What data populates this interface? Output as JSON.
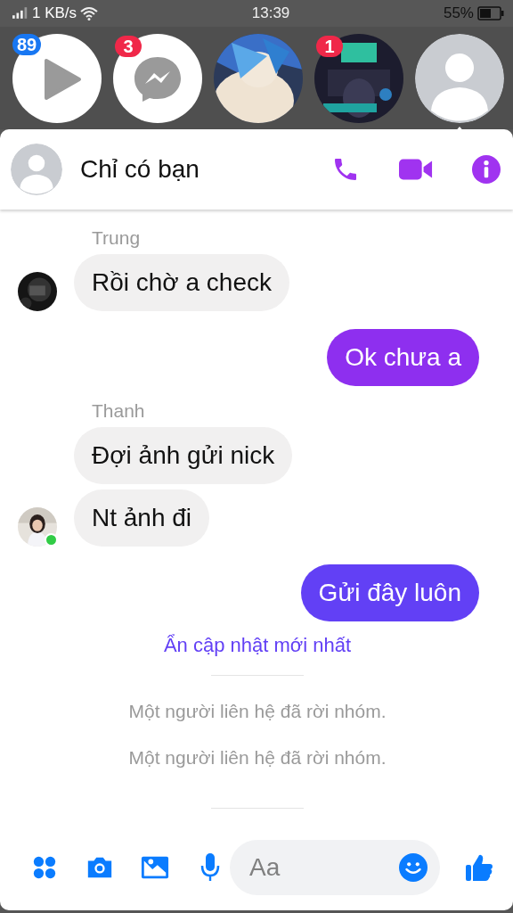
{
  "status_bar": {
    "speed": "1 KB/s",
    "time": "13:39",
    "battery": "55%"
  },
  "chat_heads": [
    {
      "kind": "play",
      "selected": false,
      "badge": {
        "text": "89",
        "color": "#1877f2"
      }
    },
    {
      "kind": "messenger",
      "selected": false,
      "badge": {
        "text": "3",
        "color": "#f02849"
      }
    },
    {
      "kind": "picture",
      "selected": false
    },
    {
      "kind": "picture",
      "selected": false,
      "badge": {
        "text": "1",
        "color": "#f02849"
      }
    },
    {
      "kind": "avatar",
      "selected": true
    }
  ],
  "header": {
    "title": "Chỉ có bạn"
  },
  "messages": [
    {
      "kind": "sender",
      "text": "Trung"
    },
    {
      "kind": "incoming",
      "text": "Rồi chờ a check",
      "avatar": {
        "online": false
      }
    },
    {
      "kind": "outgoing",
      "text": "Ok chưa a",
      "color": "#8e2fef"
    },
    {
      "kind": "sender",
      "text": "Thanh"
    },
    {
      "kind": "incoming",
      "text": "Đợi ảnh gửi nick"
    },
    {
      "kind": "incoming",
      "text": "Nt ảnh đi",
      "avatar": {
        "online": true
      }
    },
    {
      "kind": "outgoing",
      "text": "Gửi đây luôn",
      "color": "#6240f5"
    },
    {
      "kind": "link",
      "text": "Ẩn cập nhật mới nhất"
    },
    {
      "kind": "divider"
    },
    {
      "kind": "notice",
      "text": "Một người liên hệ đã rời nhóm."
    },
    {
      "kind": "notice",
      "text": "Một người liên hệ đã rời nhóm."
    },
    {
      "kind": "divider"
    }
  ],
  "composer": {
    "placeholder": "Aa"
  }
}
